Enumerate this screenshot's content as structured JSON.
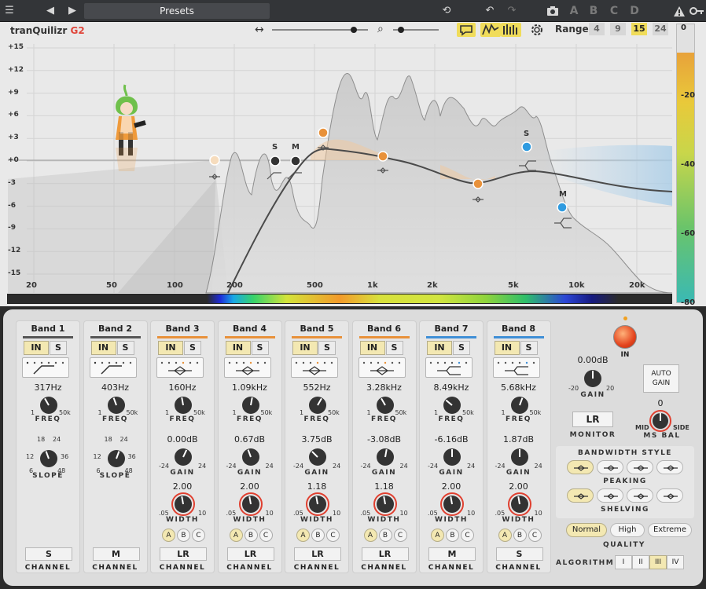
{
  "topbar": {
    "title": "Presets",
    "slots": [
      "A",
      "B",
      "C",
      "D"
    ]
  },
  "app": {
    "name": "tranQuilizr",
    "version": "G2"
  },
  "toolbar": {
    "range_label": "Range",
    "range_values": [
      "4",
      "9",
      "15",
      "24"
    ],
    "range_selected": "15"
  },
  "plot": {
    "y_labels": [
      "+15",
      "+12",
      "+9",
      "+6",
      "+3",
      "+0",
      "-3",
      "-6",
      "-9",
      "-12",
      "-15"
    ],
    "x_labels": [
      "20",
      "50",
      "100",
      "200",
      "500",
      "1k",
      "2k",
      "5k",
      "10k",
      "20k"
    ],
    "node_labels": {
      "s1": "S",
      "m1": "M",
      "s2": "S",
      "m2": "M"
    }
  },
  "meter": {
    "labels": [
      "0",
      "-20",
      "-40",
      "-60",
      "-80"
    ]
  },
  "bands": [
    {
      "name": "Band 1",
      "freq": "317Hz",
      "slope": "",
      "gain": "",
      "width": "",
      "channel": "S",
      "color": "#555555",
      "type": "lowcut"
    },
    {
      "name": "Band 2",
      "freq": "403Hz",
      "slope": "",
      "gain": "",
      "width": "",
      "channel": "M",
      "color": "#555555",
      "type": "lowcut"
    },
    {
      "name": "Band 3",
      "freq": "160Hz",
      "gain": "0.00dB",
      "width": "2.00",
      "channel": "LR",
      "color": "#e8913a",
      "type": "peak"
    },
    {
      "name": "Band 4",
      "freq": "1.09kHz",
      "gain": "0.67dB",
      "width": "2.00",
      "channel": "LR",
      "color": "#e8913a",
      "type": "peak"
    },
    {
      "name": "Band 5",
      "freq": "552Hz",
      "gain": "3.75dB",
      "width": "1.18",
      "channel": "LR",
      "color": "#e8913a",
      "type": "peak"
    },
    {
      "name": "Band 6",
      "freq": "3.28kHz",
      "gain": "-3.08dB",
      "width": "1.18",
      "channel": "LR",
      "color": "#e8913a",
      "type": "peak"
    },
    {
      "name": "Band 7",
      "freq": "8.49kHz",
      "gain": "-6.16dB",
      "width": "2.00",
      "channel": "M",
      "color": "#3f8fd6",
      "type": "shelf"
    },
    {
      "name": "Band 8",
      "freq": "5.68kHz",
      "gain": "1.87dB",
      "width": "2.00",
      "channel": "S",
      "color": "#3f8fd6",
      "type": "shelf"
    }
  ],
  "labels": {
    "in": "IN",
    "s": "S",
    "freq": "FREQ",
    "slope": "SLOPE",
    "gain": "GAIN",
    "width": "WIDTH",
    "channel": "CHANNEL",
    "freq_min": "1",
    "freq_max": "50k",
    "gain_min": "-24",
    "gain_max": "24",
    "width_min": ".05",
    "width_max": "10",
    "slope_ticks": [
      "6",
      "12",
      "18",
      "24",
      "36",
      "48"
    ],
    "abc": [
      "A",
      "B",
      "C"
    ]
  },
  "master": {
    "gain_value": "0.00dB",
    "gain_label": "GAIN",
    "gain_min": "-20",
    "gain_max": "20",
    "in_label": "IN",
    "auto_gain": "AUTO GAIN",
    "monitor_value": "LR",
    "monitor_label": "MONITOR",
    "ms_bal_value": "0",
    "ms_bal_label": "MS BAL",
    "ms_mid": "MID",
    "ms_side": "SIDE",
    "bw_title": "BANDWIDTH STYLE",
    "peaking": "PEAKING",
    "shelving": "SHELVING",
    "quality_title": "QUALITY",
    "quality": [
      "Normal",
      "High",
      "Extreme"
    ],
    "quality_selected": "Normal",
    "algorithm_title": "ALGORITHM",
    "algorithm": [
      "I",
      "II",
      "III",
      "IV"
    ],
    "algorithm_selected": "III"
  }
}
